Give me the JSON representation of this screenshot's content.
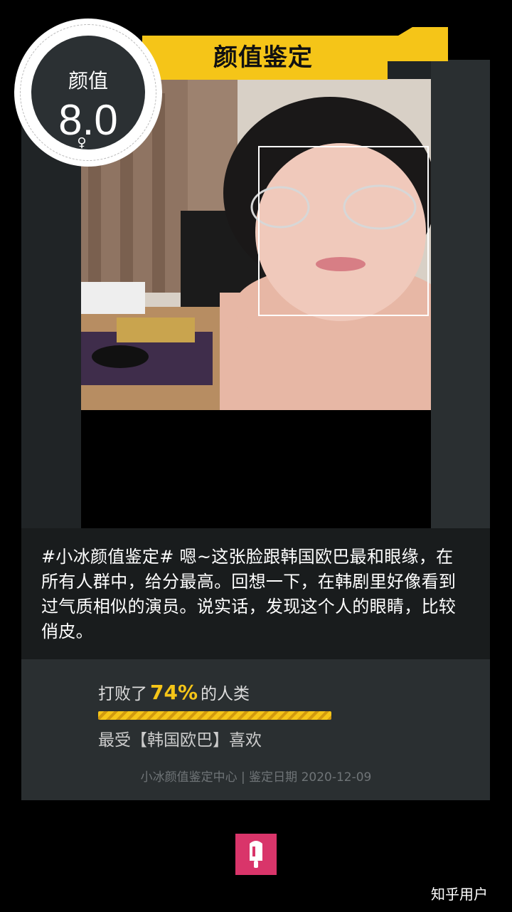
{
  "badge": {
    "label": "颜值",
    "score": "8.0",
    "gender": "♀"
  },
  "banner": {
    "title": "颜值鉴定"
  },
  "description": "#小冰颜值鉴定# 嗯~这张脸跟韩国欧巴最和眼缘，在所有人群中，给分最高。回想一下，在韩剧里好像看到过气质相似的演员。说实话，发现这个人的眼睛，比较俏皮。",
  "stats": {
    "beat_prefix": "打败了",
    "beat_percent": "74%",
    "beat_suffix": "的人类",
    "beat_progress": 0.74,
    "favorite": "最受【韩国欧巴】喜欢"
  },
  "footer": "小冰颜值鉴定中心 | 鉴定日期 2020-12-09",
  "watermark": "知乎用户",
  "colors": {
    "accent": "#f5c518",
    "brand": "#d9356a"
  }
}
